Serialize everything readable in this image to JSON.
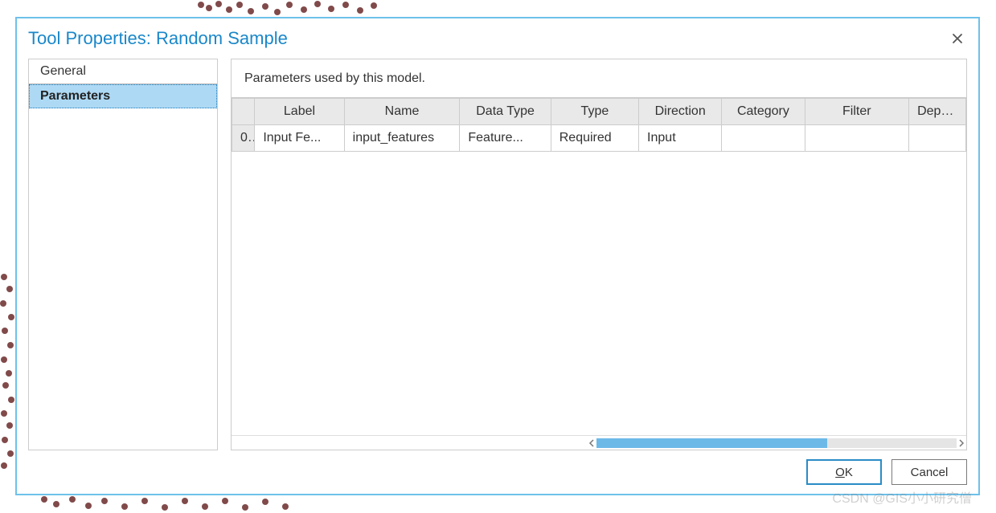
{
  "dialog": {
    "title": "Tool Properties: Random Sample"
  },
  "sidebar": {
    "items": [
      {
        "label": "General",
        "selected": false
      },
      {
        "label": "Parameters",
        "selected": true
      }
    ]
  },
  "main": {
    "description": "Parameters used by this model.",
    "columns": {
      "label": "Label",
      "name": "Name",
      "data_type": "Data Type",
      "type": "Type",
      "direction": "Direction",
      "category": "Category",
      "filter": "Filter",
      "dependency": "Dependency"
    },
    "rows": [
      {
        "index": "0",
        "label": "Input Fe...",
        "name": "input_features",
        "data_type": "Feature...",
        "type": "Required",
        "direction": "Input",
        "category": "",
        "filter": "",
        "dependency": ""
      }
    ]
  },
  "footer": {
    "ok": "OK",
    "cancel": "Cancel"
  },
  "watermark": "CSDN @GIS小小研究僧"
}
